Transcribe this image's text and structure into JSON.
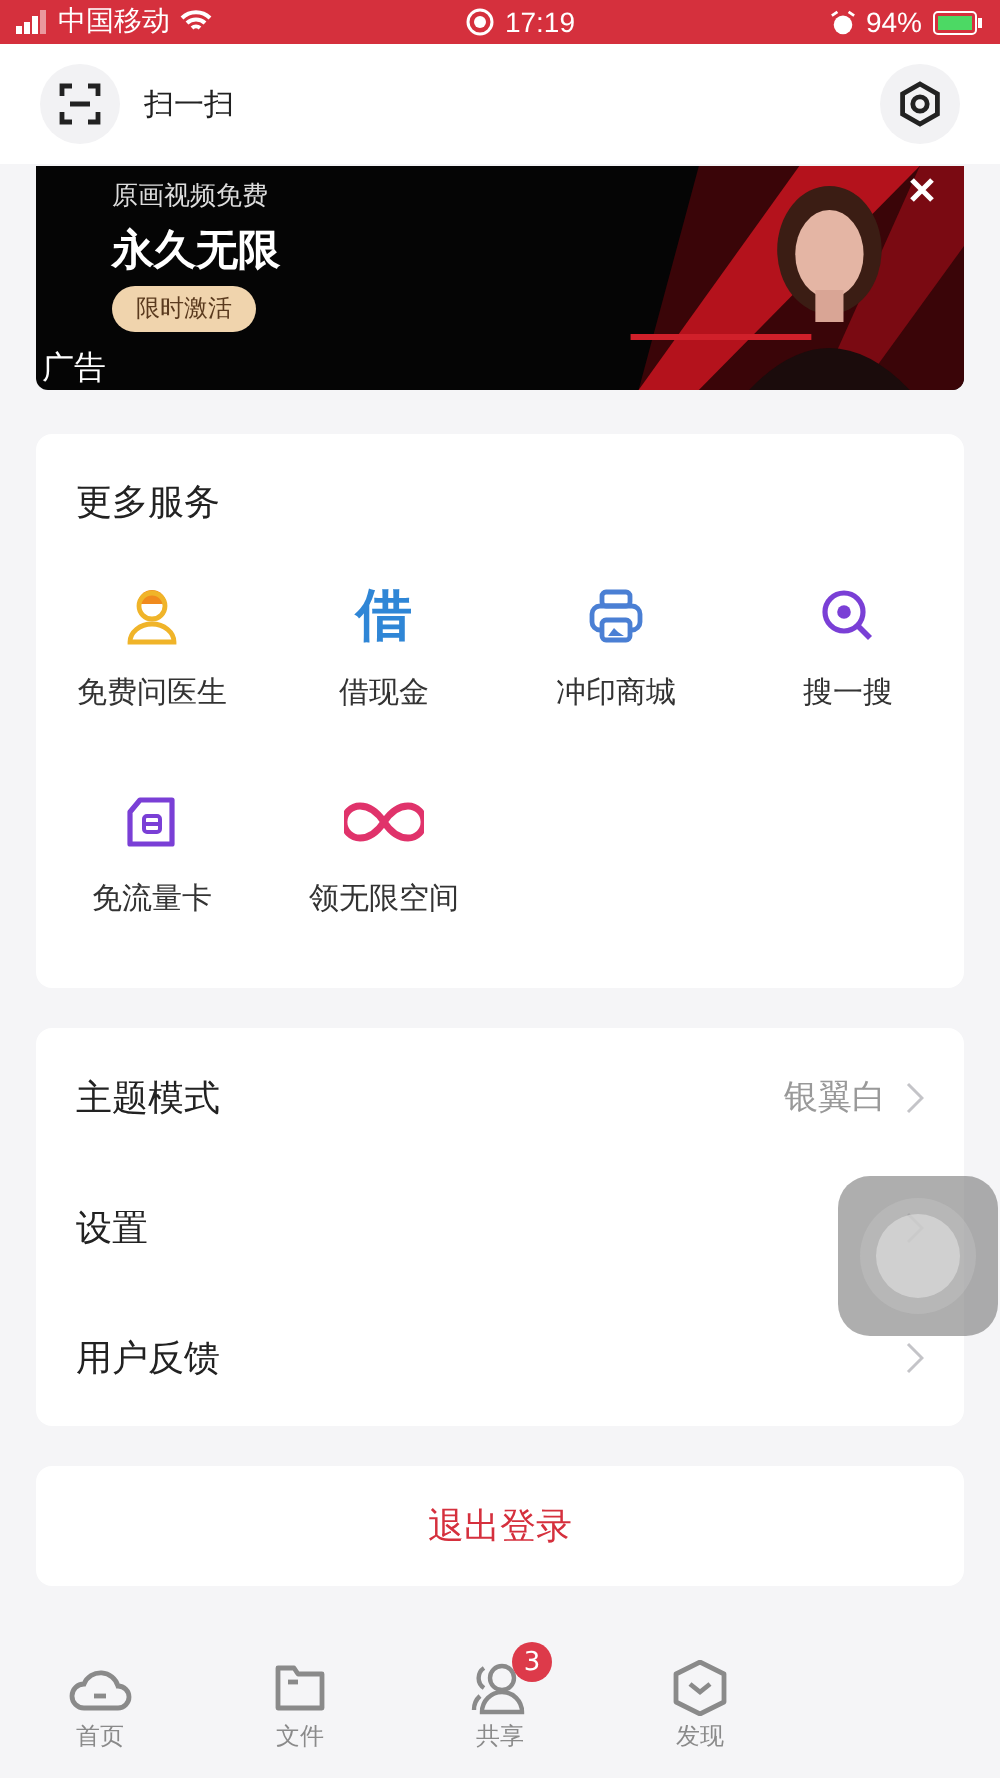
{
  "status_bar": {
    "carrier": "中国移动",
    "time": "17:19",
    "battery": "94%"
  },
  "header": {
    "scan_label": "扫一扫"
  },
  "ad": {
    "subtitle": "原画视频免费",
    "headline": "永久无限",
    "button": "限时激活",
    "tag": "广告"
  },
  "services": {
    "title": "更多服务",
    "items": [
      {
        "label": "免费问医生",
        "kind": "doctor"
      },
      {
        "label": "借现金",
        "kind": "loan",
        "glyph": "借"
      },
      {
        "label": "冲印商城",
        "kind": "printer"
      },
      {
        "label": "搜一搜",
        "kind": "search"
      },
      {
        "label": "免流量卡",
        "kind": "simcard"
      },
      {
        "label": "领无限空间",
        "kind": "infinity"
      }
    ]
  },
  "settings": [
    {
      "label": "主题模式",
      "value": "银翼白"
    },
    {
      "label": "设置"
    },
    {
      "label": "用户反馈"
    }
  ],
  "logout": "退出登录",
  "tabs": [
    {
      "label": "首页",
      "kind": "cloud",
      "selected": false
    },
    {
      "label": "文件",
      "kind": "folder",
      "selected": false
    },
    {
      "label": "共享",
      "kind": "people",
      "selected": false,
      "badge": "3"
    },
    {
      "label": "发现",
      "kind": "discover",
      "selected": false
    }
  ]
}
